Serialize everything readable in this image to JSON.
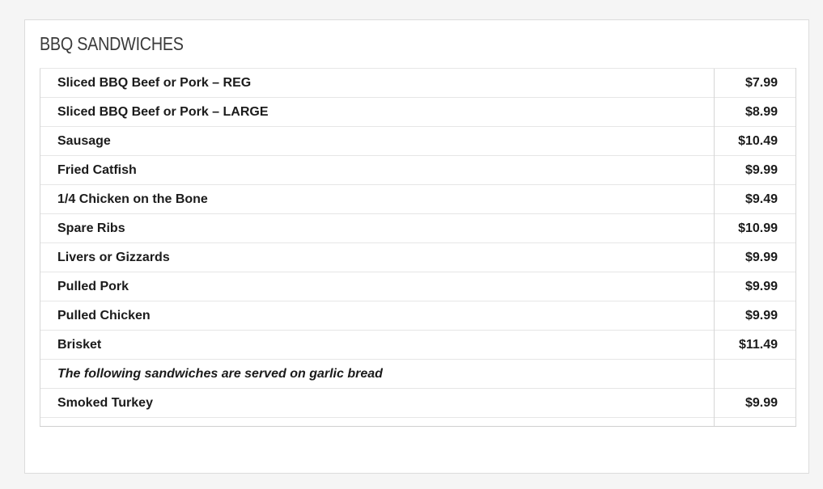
{
  "section": {
    "title": "BBQ SANDWICHES"
  },
  "menu": {
    "items": [
      {
        "name": "Sliced BBQ Beef or Pork – REG",
        "price": "$7.99"
      },
      {
        "name": "Sliced BBQ Beef or Pork – LARGE",
        "price": "$8.99"
      },
      {
        "name": "Sausage",
        "price": "$10.49"
      },
      {
        "name": "Fried Catfish",
        "price": "$9.99"
      },
      {
        "name": "1/4 Chicken on the Bone",
        "price": "$9.49"
      },
      {
        "name": "Spare Ribs",
        "price": "$10.99"
      },
      {
        "name": "Livers or Gizzards",
        "price": "$9.99"
      },
      {
        "name": "Pulled Pork",
        "price": "$9.99"
      },
      {
        "name": "Pulled Chicken",
        "price": "$9.99"
      },
      {
        "name": "Brisket",
        "price": "$11.49"
      },
      {
        "name": "The following sandwiches are served on garlic bread",
        "price": ""
      },
      {
        "name": "Smoked Turkey",
        "price": "$9.99"
      }
    ]
  }
}
